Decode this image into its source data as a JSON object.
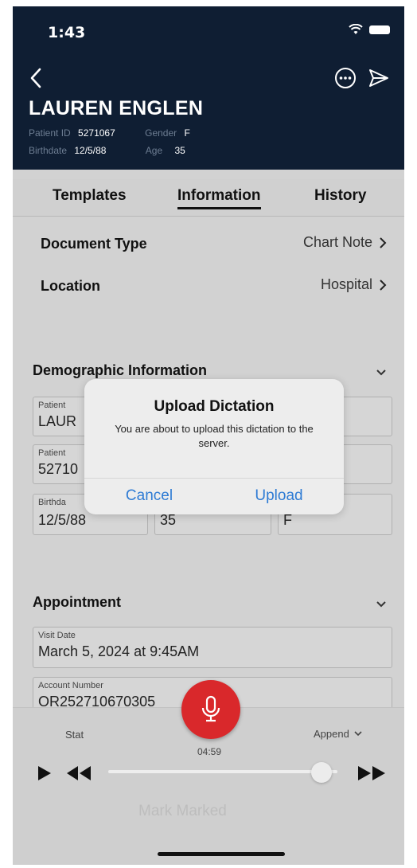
{
  "status_bar": {
    "time": "1:43"
  },
  "header": {
    "patient_name": "LAUREN ENGLEN",
    "patient_id_label": "Patient ID",
    "patient_id": "5271067",
    "gender_label": "Gender",
    "gender": "F",
    "birthdate_label": "Birthdate",
    "birthdate": "12/5/88",
    "age_label": "Age",
    "age": "35"
  },
  "tabs": [
    "Templates",
    "Information",
    "History"
  ],
  "active_tab": "Information",
  "rows": {
    "document_type": {
      "label": "Document Type",
      "value": "Chart Note"
    },
    "location": {
      "label": "Location",
      "value": "Hospital"
    }
  },
  "demographic": {
    "title": "Demographic Information",
    "patient_name_label": "Patient",
    "patient_name_value": "LAUR",
    "patient_id_label": "Patient",
    "patient_id_value": "52710",
    "birthdate_label": "Birthda",
    "birthdate_value": "12/5/88",
    "age_value": "35",
    "gender_value": "F"
  },
  "appointment": {
    "title": "Appointment",
    "visit_date_label": "Visit Date",
    "visit_date_value": "March 5, 2024 at 9:45AM",
    "account_number_label": "Account Number",
    "account_number_value": "OR252710670305"
  },
  "player": {
    "mode": "Stat",
    "append_label": "Append",
    "time": "04:59",
    "mark_label": "Mark Marked",
    "progress_fraction": 0.93
  },
  "dialog": {
    "title": "Upload Dictation",
    "message": "You are about to upload this dictation to the server.",
    "cancel_label": "Cancel",
    "upload_label": "Upload"
  },
  "colors": {
    "header_bg": "#0f1e33",
    "accent_blue": "#2e7bd4",
    "record_red": "#d9282b"
  },
  "icons": {
    "back": "chevron-left-icon",
    "more": "ellipsis-circle-icon",
    "send": "paper-plane-icon",
    "mic": "microphone-icon"
  }
}
